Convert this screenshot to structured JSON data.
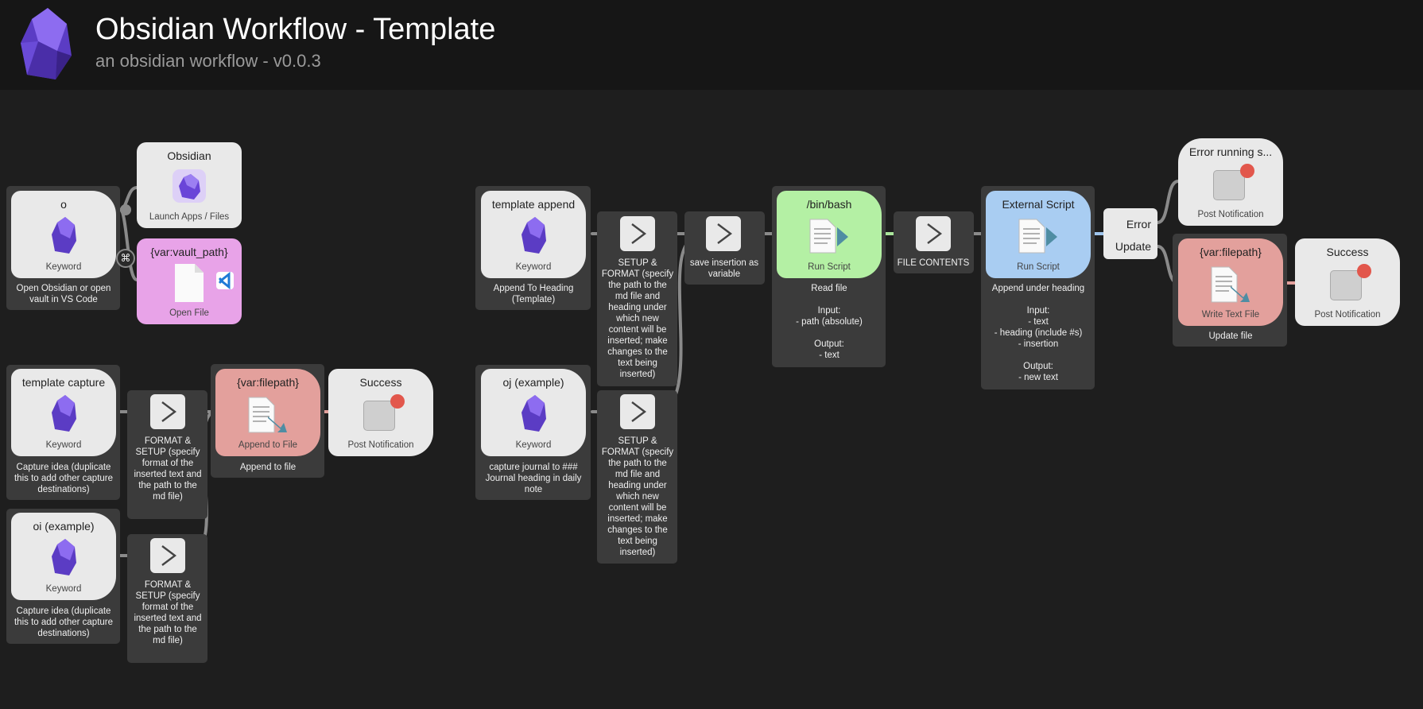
{
  "header": {
    "title": "Obsidian Workflow - Template",
    "subtitle": "an obsidian workflow - v0.0.3"
  },
  "colors": {
    "canvas": "#1e1e1e",
    "header": "#161616",
    "frame": "#3b3b3b",
    "card": "#e9e9e9",
    "open_file": "#e8a3e8",
    "run_script": "#b4f0a4",
    "external_script": "#a9cdf2",
    "file_action": "#e3a09c",
    "wire": "#8a8a8a",
    "wire_green": "#a9e59a",
    "wire_blue": "#9ec4ec",
    "wire_red": "#e3a09c"
  },
  "row1": {
    "keyword_o": {
      "title": "o",
      "type": "Keyword",
      "note": "Open Obsidian or open vault in VS Code",
      "icon": "obsidian-icon"
    },
    "mod_key": "⌘",
    "launch_obsidian": {
      "title": "Obsidian",
      "type": "Launch Apps / Files",
      "icon": "obsidian-app-icon"
    },
    "open_file": {
      "title": "{var:vault_path}",
      "type": "Open File",
      "icon": "file-icon"
    }
  },
  "row2": {
    "template_capture": {
      "title": "template capture",
      "type": "Keyword",
      "note": "Capture idea (duplicate this to add other capture destinations)"
    },
    "format_setup_1": {
      "note": "FORMAT & SETUP (specify format of the inserted text and the path to the md file)",
      "icon": "chevron-right-icon"
    },
    "append_to_file": {
      "title": "{var:filepath}",
      "type": "Append to File",
      "note": "Append to file"
    },
    "success_1": {
      "title": "Success",
      "type": "Post Notification"
    }
  },
  "row3": {
    "oi_example": {
      "title": "oi (example)",
      "type": "Keyword",
      "note": "Capture idea (duplicate this to add other capture destinations)"
    },
    "format_setup_2": {
      "note": "FORMAT & SETUP (specify format of the inserted text and the path to the md file)"
    }
  },
  "template_append": {
    "keyword": {
      "title": "template append",
      "type": "Keyword",
      "note": "Append To Heading (Template)"
    },
    "setup_format": {
      "note": "SETUP & FORMAT (specify the path to the md file and heading under which new content will be inserted; make changes to the text being inserted)"
    },
    "save_variable": {
      "note": "save insertion as variable"
    },
    "bin_bash": {
      "title": "/bin/bash",
      "type": "Run Script",
      "note": "Read file\n\nInput:\n- path (absolute)\n\nOutput:\n- text"
    },
    "file_contents": {
      "note": "FILE CONTENTS"
    },
    "external_script": {
      "title": "External Script",
      "type": "Run Script",
      "note": "Append under heading\n\nInput:\n- text\n- heading (include #s)\n- insertion\n\nOutput:\n- new text"
    },
    "conditional": {
      "error": "Error",
      "update": "Update"
    },
    "error_notification": {
      "title": "Error running s...",
      "type": "Post Notification"
    },
    "write_text_file": {
      "title": "{var:filepath}",
      "type": "Write Text File",
      "note": "Update file"
    },
    "success_2": {
      "title": "Success",
      "type": "Post Notification"
    }
  },
  "oj_example": {
    "keyword": {
      "title": "oj (example)",
      "type": "Keyword",
      "note": "capture journal to ### Journal heading in daily note"
    },
    "setup_format": {
      "note": "SETUP & FORMAT (specify the path to the md file and heading under which new content will be inserted; make changes to the text being inserted)"
    }
  }
}
